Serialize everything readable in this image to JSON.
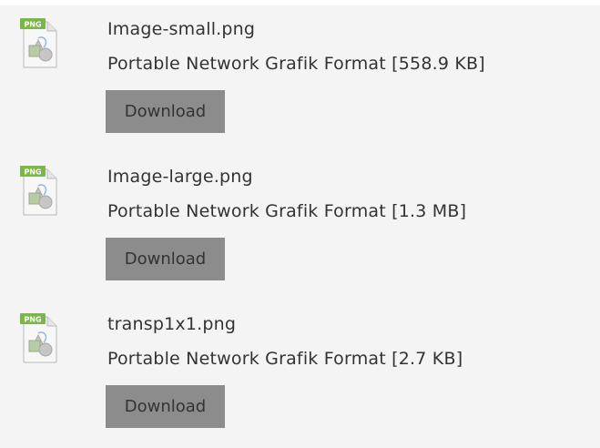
{
  "files": [
    {
      "icon": "png-file-icon",
      "icon_label": "PNG",
      "name": "Image-small.png",
      "description": "Portable Network Grafik Format [558.9 KB]",
      "button_label": "Download"
    },
    {
      "icon": "png-file-icon",
      "icon_label": "PNG",
      "name": "Image-large.png",
      "description": "Portable Network Grafik Format [1.3 MB]",
      "button_label": "Download"
    },
    {
      "icon": "png-file-icon",
      "icon_label": "PNG",
      "name": "transp1x1.png",
      "description": "Portable Network Grafik Format [2.7 KB]",
      "button_label": "Download"
    }
  ],
  "colors": {
    "panel_background": "#f4f4f4",
    "button_background": "#8c8c8c",
    "text": "#333333",
    "icon_badge": "#7ab648"
  }
}
